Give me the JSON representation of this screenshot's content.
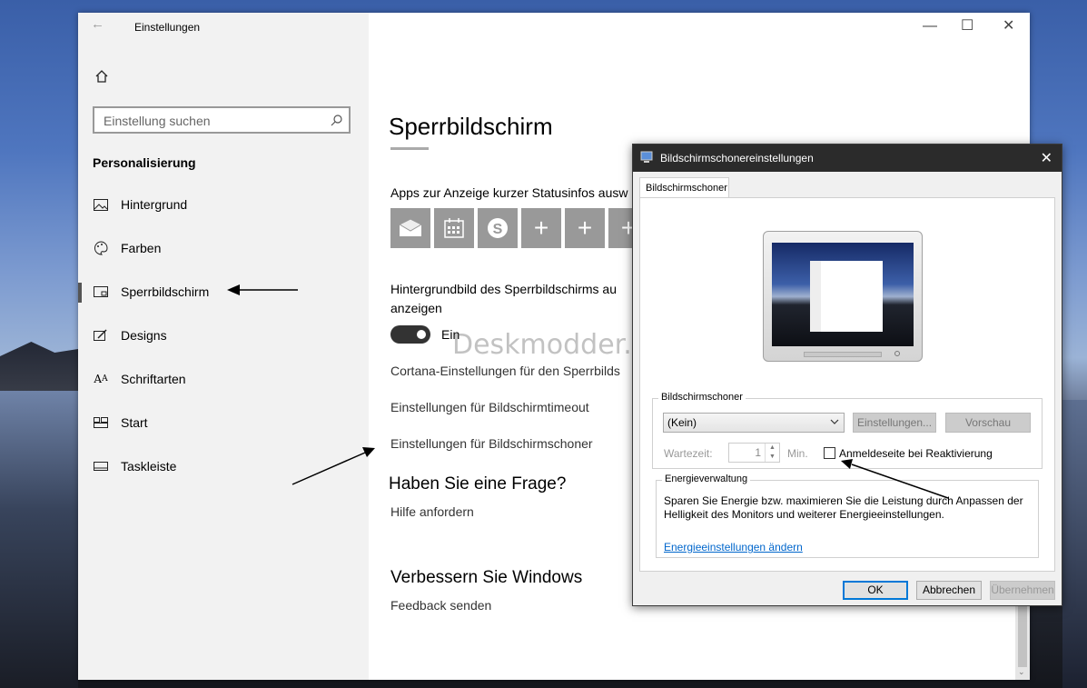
{
  "window": {
    "title": "Einstellungen",
    "back_icon": "back-arrow-icon"
  },
  "sidebar": {
    "search_placeholder": "Einstellung suchen",
    "section": "Personalisierung",
    "items": [
      {
        "label": "Hintergrund",
        "icon": "image-icon"
      },
      {
        "label": "Farben",
        "icon": "palette-icon"
      },
      {
        "label": "Sperrbildschirm",
        "icon": "lockscreen-icon",
        "selected": true
      },
      {
        "label": "Designs",
        "icon": "designs-icon"
      },
      {
        "label": "Schriftarten",
        "icon": "font-icon"
      },
      {
        "label": "Start",
        "icon": "start-icon"
      },
      {
        "label": "Taskleiste",
        "icon": "taskbar-icon"
      }
    ]
  },
  "main": {
    "title": "Sperrbildschirm",
    "apps_label": "Apps zur Anzeige kurzer Statusinfos ausw",
    "tiles": [
      "mail-icon",
      "calendar-icon",
      "skype-icon",
      "plus-icon",
      "plus-icon",
      "plus-icon"
    ],
    "background_label_1": "Hintergrundbild des Sperrbildschirms au",
    "background_label_2": "anzeigen",
    "toggle_label": "Ein",
    "link_cortana": "Cortana-Einstellungen für den Sperrbilds",
    "link_timeout": "Einstellungen für Bildschirmtimeout",
    "link_screensaver": "Einstellungen für Bildschirmschoner",
    "question_heading": "Haben Sie eine Frage?",
    "help_link": "Hilfe anfordern",
    "improve_heading": "Verbessern Sie Windows",
    "feedback_link": "Feedback senden",
    "watermark": "Deskmodder.de"
  },
  "dialog": {
    "title": "Bildschirmschonereinstellungen",
    "tab": "Bildschirmschoner",
    "group_screensaver": "Bildschirmschoner",
    "selected": "(Kein)",
    "settings_button": "Einstellungen...",
    "preview_button": "Vorschau",
    "wait_label": "Wartezeit:",
    "wait_value": "1",
    "wait_unit": "Min.",
    "resume_label": "Anmeldeseite bei Reaktivierung",
    "group_power": "Energieverwaltung",
    "power_text_1": "Sparen Sie Energie bzw. maximieren Sie die Leistung durch Anpassen der",
    "power_text_2": "Helligkeit des Monitors und weiterer Energieeinstellungen.",
    "power_link": "Energieeinstellungen ändern",
    "ok": "OK",
    "cancel": "Abbrechen",
    "apply": "Übernehmen"
  },
  "colors": {
    "accent": "#0078d7",
    "sidebar_bg": "#f2f2f2",
    "tile_bg": "#999999",
    "dialog_title_bg": "#2b2b2b"
  }
}
